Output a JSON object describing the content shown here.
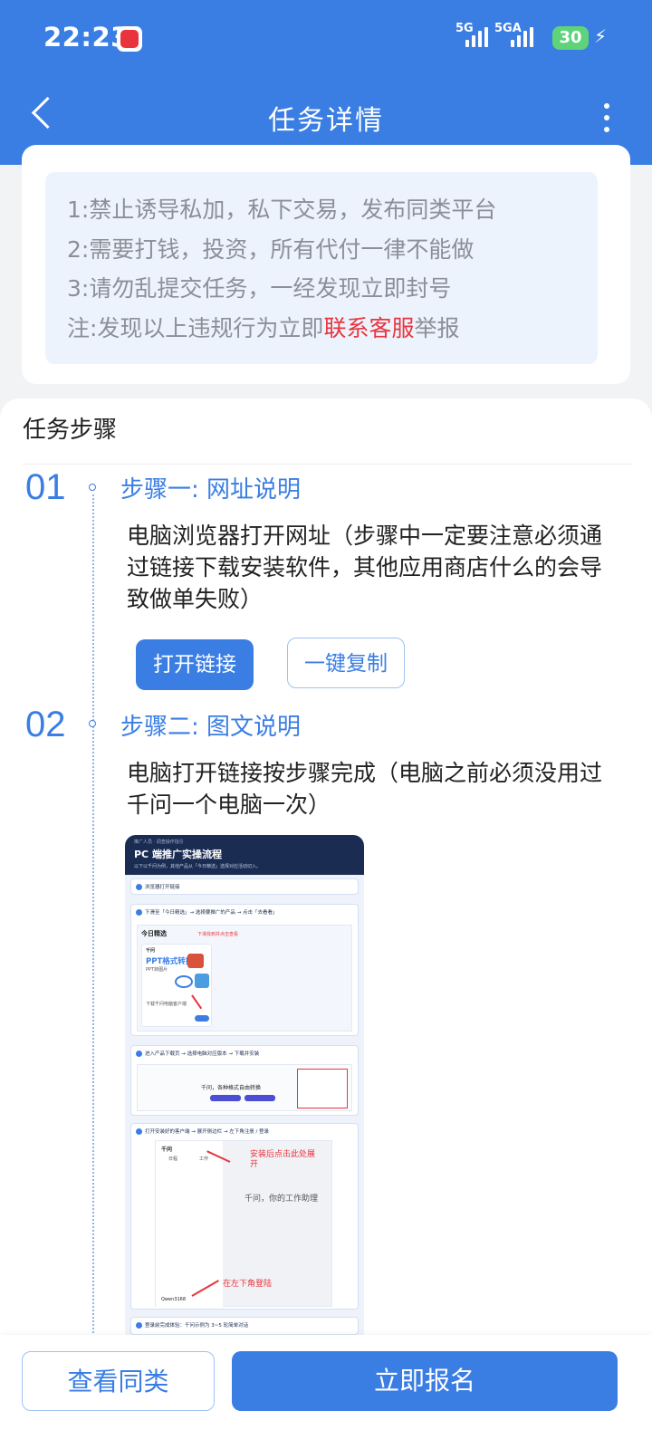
{
  "status_bar": {
    "time": "22:23",
    "network_1": "5G",
    "network_2": "5GA",
    "battery": "30"
  },
  "nav": {
    "title": "任务详情"
  },
  "rules": {
    "line1": "1:禁止诱导私加，私下交易，发布同类平台",
    "line2": "2:需要打钱，投资，所有代付一律不能做",
    "line3": "3:请勿乱提交任务，一经发现立即封号",
    "line4_prefix": "注:发现以上违规行为立即",
    "line4_link": "联系客服",
    "line4_suffix": "举报"
  },
  "steps": {
    "section_title": "任务步骤",
    "step1": {
      "number": "01",
      "title": "步骤一: 网址说明",
      "description": "电脑浏览器打开网址（步骤中一定要注意必须通过链接下载安装软件，其他应用商店什么的会导致做单失败）",
      "open_link_label": "打开链接",
      "copy_label": "一键复制"
    },
    "step2": {
      "number": "02",
      "title": "步骤二: 图文说明",
      "description": "电脑打开链接按步骤完成（电脑之前必须没用过千问一个电脑一次）"
    }
  },
  "guide_image": {
    "crumb": "推广人员 · 调查操作指引",
    "title": "PC 端推广实操流程",
    "subtitle": "以下以千问为例，其他产品从「今日精选」选择对应活动切入。",
    "s1": "浏览器打开链接",
    "s2": "下滑至「今日精选」→ 选择要推广的产品 → 点击「去看看」",
    "s2_heading": "今日精选",
    "s2_note": "下滑找到并点击查看",
    "s2_brand": "千问",
    "s2_ppt": "PPT格式转换",
    "s2_ppt_sub": "PPT转图片",
    "s2_action": "下载千问电脑客户端",
    "s3": "进入产品下载页 → 选择电脑对应版本 → 下载并安装",
    "s3_center": "千问，各种格式自由转换",
    "s4": "打开安装好的客户端 → 展开侧边栏 → 左下角注册 / 登录",
    "s4_app": "千问",
    "s4_tab1": "日程",
    "s4_tab2": "工作",
    "s4_note1": "安装后点击此处展开",
    "s4_welcome": "千问，你的工作助理",
    "s4_note2": "在左下角登陆",
    "s4_user": "Qwen3168",
    "s5": "登录前完成体验：千问示例为 3~5 轮简单对话"
  },
  "actions": {
    "similar_label": "查看同类",
    "signup_label": "立即报名"
  },
  "colors": {
    "primary": "#3a7ee4",
    "alert": "#e8353d",
    "rules_bg": "#edf3fd"
  }
}
